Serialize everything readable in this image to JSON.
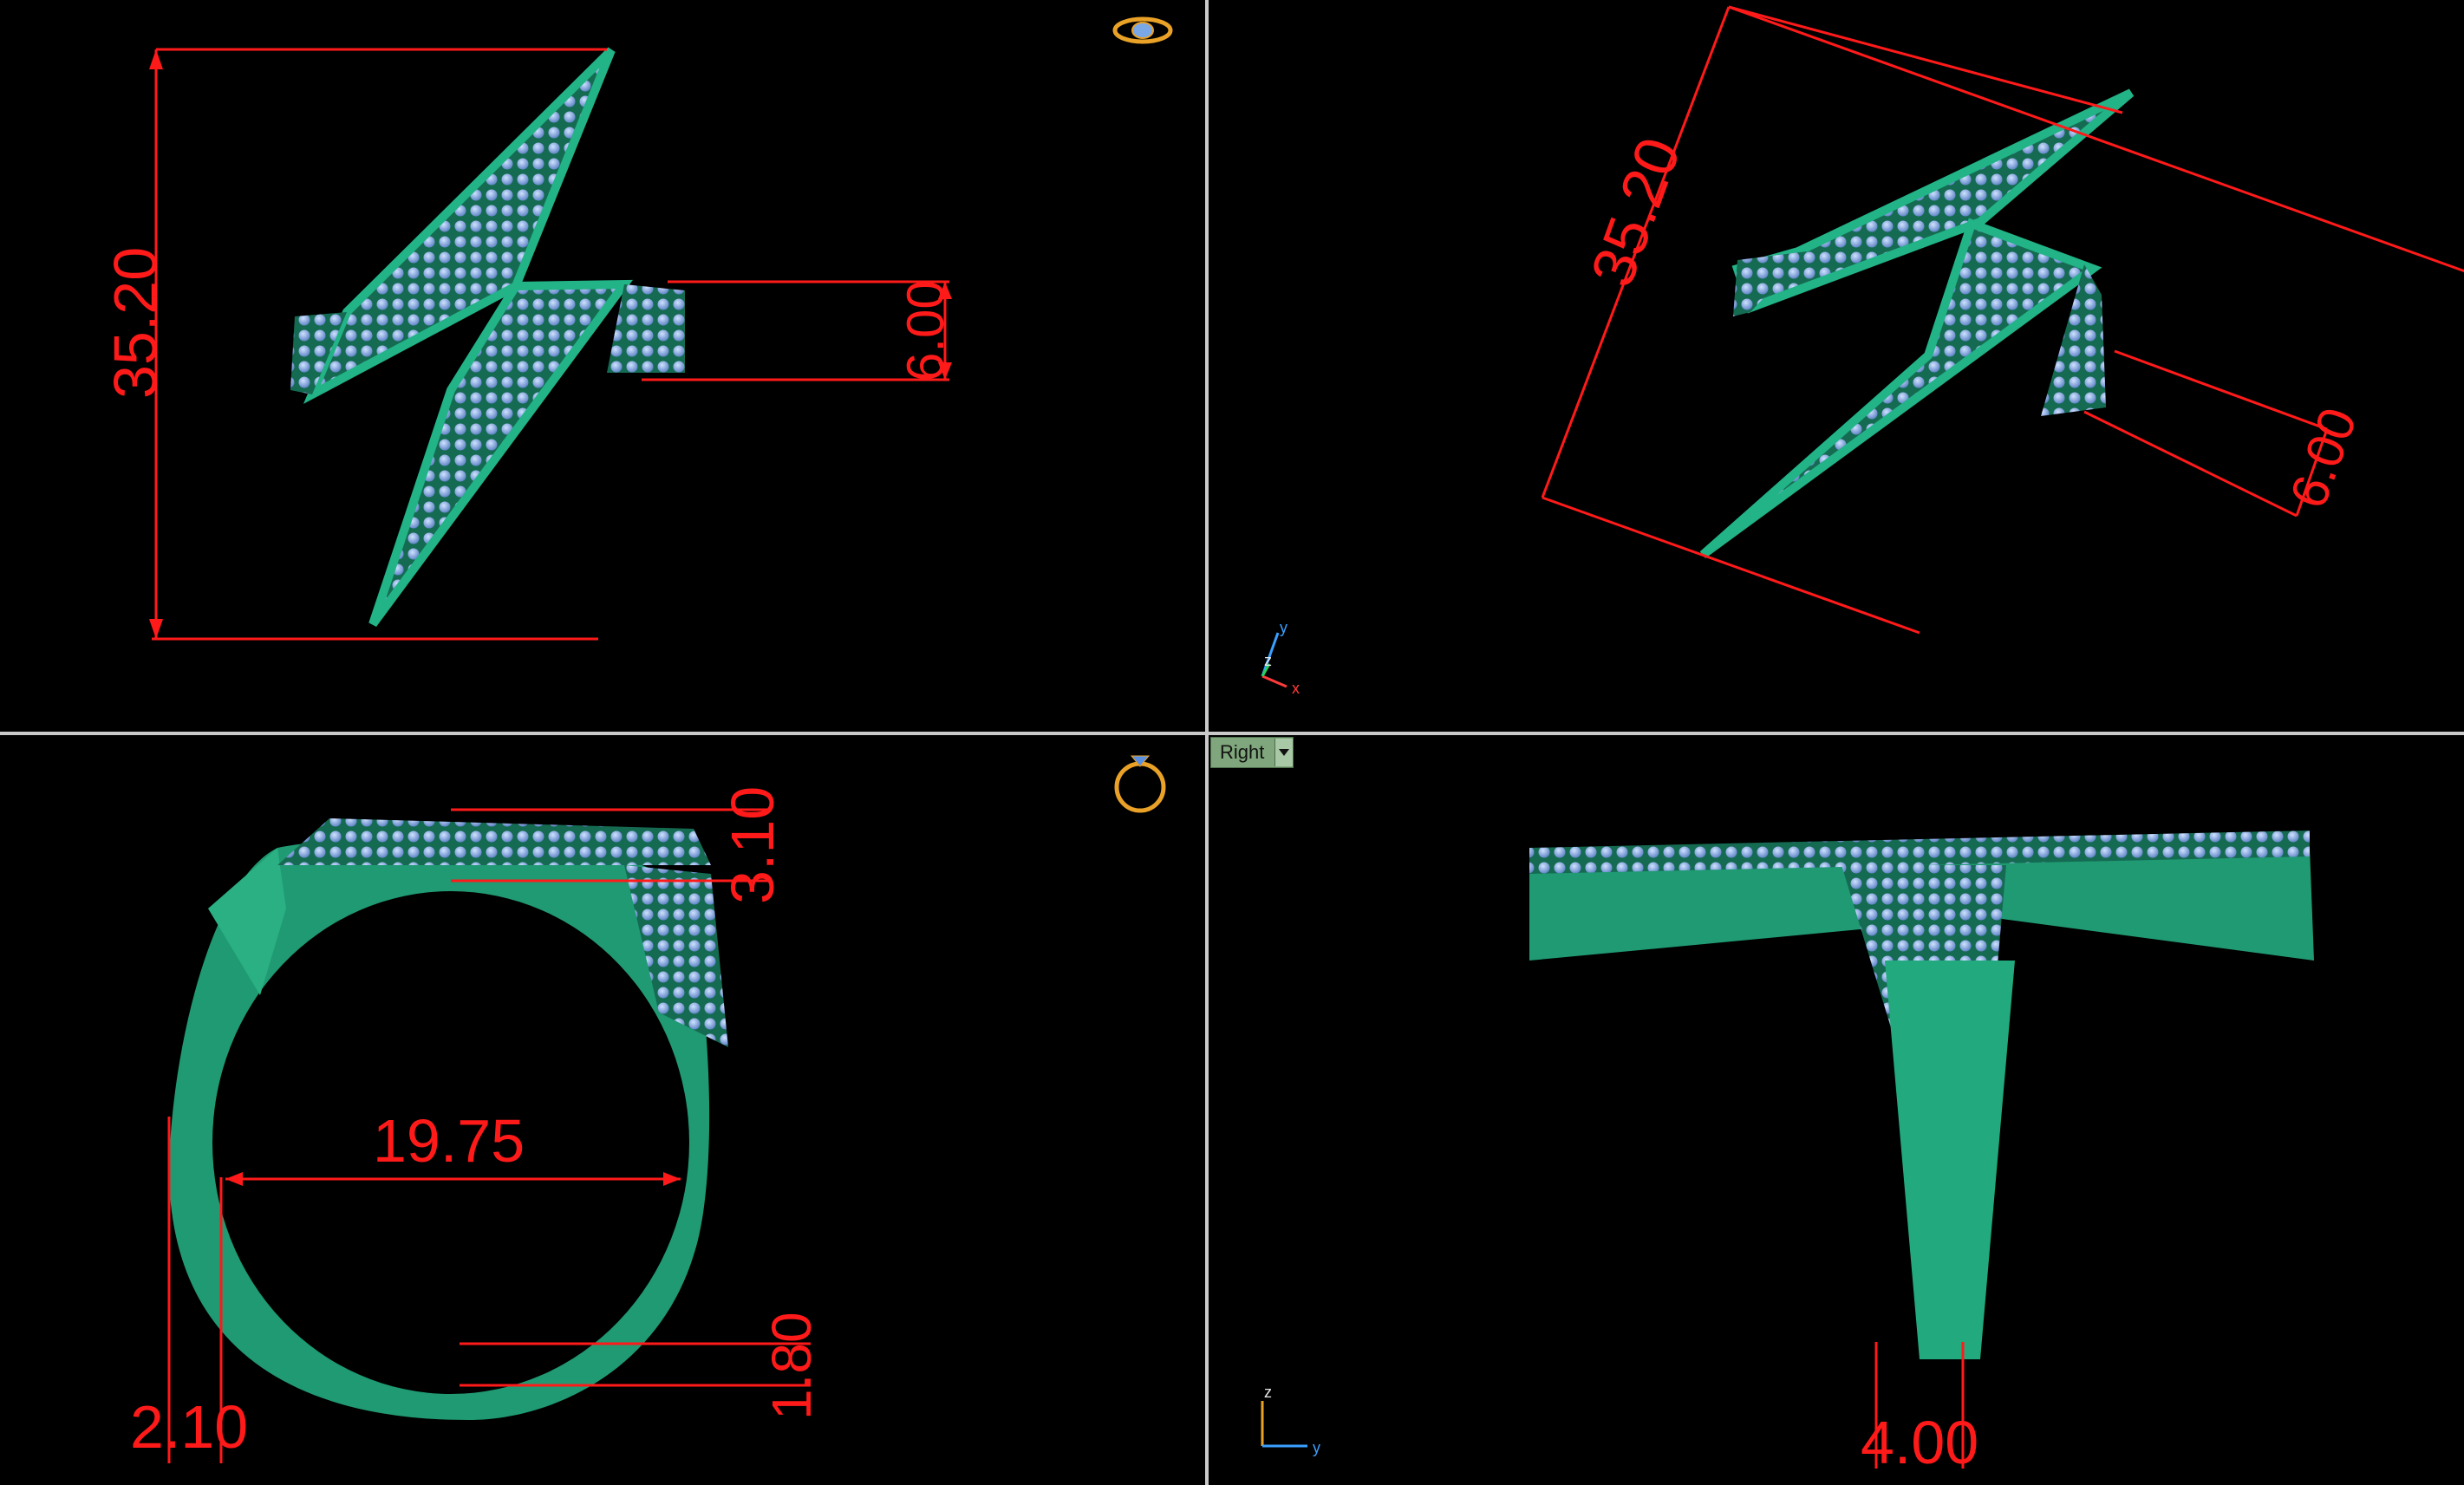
{
  "viewports": {
    "top_left": {
      "dimensions": {
        "height": "35.20",
        "width": "6.00"
      }
    },
    "top_right": {
      "dimensions": {
        "height": "35.20",
        "width": "6.00"
      },
      "axes": {
        "x": "x",
        "y": "y",
        "z": "z"
      }
    },
    "bottom_left": {
      "dimensions": {
        "top_thickness": "3.10",
        "inner_diameter": "19.75",
        "bottom_thickness": "1.80",
        "side_thickness": "2.10"
      }
    },
    "bottom_right": {
      "view_label": "Right",
      "dimensions": {
        "shank_width": "4.00"
      },
      "axes": {
        "y": "y",
        "z": "z"
      }
    }
  },
  "colors": {
    "background": "#000000",
    "metal": "#1f9a73",
    "stones": "#8ab4e6",
    "dimension": "#ff1a1a",
    "divider": "#c9c9c9",
    "icon": "#e9a227"
  },
  "icons": [
    "ring-topview-icon",
    "ring-sideview-icon",
    "view-dropdown-icon"
  ]
}
